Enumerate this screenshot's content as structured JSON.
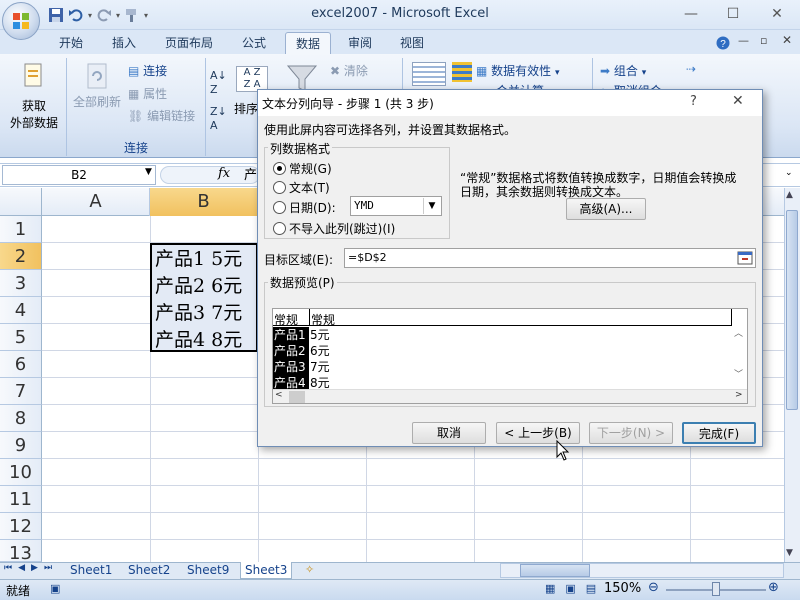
{
  "window": {
    "title": "excel2007 - Microsoft Excel",
    "min_label": "—",
    "max_label": "☐",
    "close_label": "✕"
  },
  "tabs": [
    "开始",
    "插入",
    "页面布局",
    "公式",
    "数据",
    "审阅",
    "视图"
  ],
  "ribbon": {
    "get_external": "获取\n外部数据",
    "get_external_line1": "获取",
    "get_external_line2": "外部数据",
    "refresh_all": "全部刷新",
    "connections": "连接",
    "properties": "属性",
    "edit_links": "编辑链接",
    "group_connections": "连接",
    "sort": "排序",
    "clear": "清除",
    "data_validation": "数据有效性",
    "group": "组合",
    "merge_calc": "合并计算",
    "ungroup": "取消组合"
  },
  "formula_bar": {
    "name_box": "B2",
    "fx": "fx",
    "content": "产"
  },
  "columns": [
    "A",
    "B"
  ],
  "rows": [
    "1",
    "2",
    "3",
    "4",
    "5",
    "6",
    "7",
    "8",
    "9",
    "10",
    "11",
    "12",
    "13"
  ],
  "cells": [
    "产品1  5元",
    "产品2  6元",
    "产品3  7元",
    "产品4  8元"
  ],
  "sheets": [
    "Sheet1",
    "Sheet2",
    "Sheet9",
    "Sheet3"
  ],
  "status": {
    "ready": "就绪",
    "zoom": "150%"
  },
  "dialog": {
    "title": "文本分列向导 - 步骤 1 (共 3 步)",
    "help": "?",
    "close": "✕",
    "instruction": "使用此屏内容可选择各列，并设置其数据格式。",
    "group_title": "列数据格式",
    "options": [
      "常规(G)",
      "文本(T)",
      "日期(D):",
      "不导入此列(跳过)(I)"
    ],
    "date_format": "YMD",
    "description": "“常规”数据格式将数值转换成数字，日期值会转换成日期，其余数据则转换成文本。",
    "desc_line1": "“常规”数据格式将数值转换成数字，日期值会转换成",
    "desc_line2": "日期，其余数据则转换成文本。",
    "advanced": "高级(A)...",
    "target_label": "目标区域(E):",
    "target_value": "=$D$2",
    "preview_title": "数据预览(P)",
    "preview_headers": [
      "常规",
      "常规"
    ],
    "preview_rows": [
      [
        "产品1",
        "5元"
      ],
      [
        "产品2",
        "6元"
      ],
      [
        "产品3",
        "7元"
      ],
      [
        "产品4",
        "8元"
      ]
    ],
    "buttons": {
      "cancel": "取消",
      "back": "< 上一步(B)",
      "next": "下一步(N) >",
      "finish": "完成(F)"
    }
  },
  "colors": {
    "accent": "#15428b",
    "ribbon": "#dbe7f6",
    "selection_black": "#000000"
  }
}
